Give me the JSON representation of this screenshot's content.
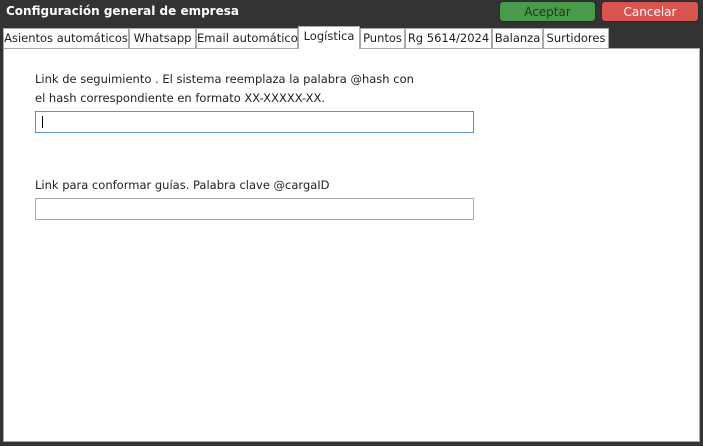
{
  "window": {
    "title": "Configuración general de empresa",
    "accept_label": "Aceptar",
    "cancel_label": "Cancelar"
  },
  "tabs": [
    {
      "label": "Asientos automáticos"
    },
    {
      "label": "Whatsapp"
    },
    {
      "label": "Email automático"
    },
    {
      "label": "Logística",
      "active": true
    },
    {
      "label": "Puntos"
    },
    {
      "label": "Rg 5614/2024"
    },
    {
      "label": "Balanza"
    },
    {
      "label": "Surtidores"
    }
  ],
  "logistica": {
    "tracking_label_line1": "Link de seguimiento . El sistema reemplaza la palabra @hash con",
    "tracking_label_line2": "el hash correspondiente en formato XX-XXXXX-XX.",
    "tracking_value": "",
    "guides_label": "Link para conformar guías. Palabra clave @cargaID",
    "guides_value": ""
  },
  "colors": {
    "accept": "#4a9a4c",
    "cancel": "#d9534f",
    "titlebar": "#333333"
  }
}
